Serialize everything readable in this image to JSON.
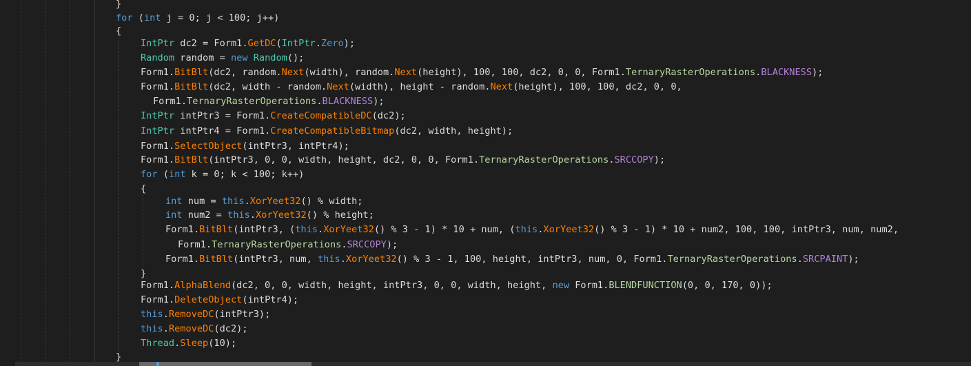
{
  "editor": {
    "lines": [
      {
        "indent": 0,
        "tokens": [
          [
            "pl",
            "}"
          ]
        ]
      },
      {
        "indent": 0,
        "tokens": [
          [
            "kw",
            "for"
          ],
          [
            "pl",
            " ("
          ],
          [
            "kw",
            "int"
          ],
          [
            "pl",
            " j = 0; j < 100; j++)"
          ]
        ]
      },
      {
        "indent": 0,
        "tokens": [
          [
            "pl",
            "{"
          ]
        ]
      },
      {
        "indent": 1,
        "tokens": [
          [
            "ty",
            "IntPtr"
          ],
          [
            "pl",
            " dc2 = "
          ],
          [
            "pl",
            "Form1."
          ],
          [
            "fn",
            "GetDC"
          ],
          [
            "pl",
            "("
          ],
          [
            "ty",
            "IntPtr"
          ],
          [
            "pl",
            "."
          ],
          [
            "kw",
            "Zero"
          ],
          [
            "pl",
            ");"
          ]
        ]
      },
      {
        "indent": 1,
        "tokens": [
          [
            "ty",
            "Random"
          ],
          [
            "pl",
            " random = "
          ],
          [
            "kw",
            "new"
          ],
          [
            "pl",
            " "
          ],
          [
            "ty",
            "Random"
          ],
          [
            "pl",
            "();"
          ]
        ]
      },
      {
        "indent": 1,
        "tokens": [
          [
            "pl",
            "Form1."
          ],
          [
            "fn",
            "BitBlt"
          ],
          [
            "pl",
            "(dc2, random."
          ],
          [
            "fn",
            "Next"
          ],
          [
            "pl",
            "(width), random."
          ],
          [
            "fn",
            "Next"
          ],
          [
            "pl",
            "(height), 100, 100, dc2, 0, 0, "
          ],
          [
            "pl",
            "Form1."
          ],
          [
            "en",
            "TernaryRasterOperations"
          ],
          [
            "pl",
            "."
          ],
          [
            "ev",
            "BLACKNESS"
          ],
          [
            "pl",
            ");"
          ]
        ]
      },
      {
        "indent": 1,
        "tokens": [
          [
            "pl",
            "Form1."
          ],
          [
            "fn",
            "BitBlt"
          ],
          [
            "pl",
            "(dc2, width - random."
          ],
          [
            "fn",
            "Next"
          ],
          [
            "pl",
            "(width), height - random."
          ],
          [
            "fn",
            "Next"
          ],
          [
            "pl",
            "(height), 100, 100, dc2, 0, 0,"
          ]
        ]
      },
      {
        "indent": 1,
        "extra": 2,
        "tokens": [
          [
            "pl",
            "Form1."
          ],
          [
            "en",
            "TernaryRasterOperations"
          ],
          [
            "pl",
            "."
          ],
          [
            "ev",
            "BLACKNESS"
          ],
          [
            "pl",
            ");"
          ]
        ]
      },
      {
        "indent": 1,
        "tokens": [
          [
            "ty",
            "IntPtr"
          ],
          [
            "pl",
            " intPtr3 = "
          ],
          [
            "pl",
            "Form1."
          ],
          [
            "fn",
            "CreateCompatibleDC"
          ],
          [
            "pl",
            "(dc2);"
          ]
        ]
      },
      {
        "indent": 1,
        "tokens": [
          [
            "ty",
            "IntPtr"
          ],
          [
            "pl",
            " intPtr4 = "
          ],
          [
            "pl",
            "Form1."
          ],
          [
            "fn",
            "CreateCompatibleBitmap"
          ],
          [
            "pl",
            "(dc2, width, height);"
          ]
        ]
      },
      {
        "indent": 1,
        "tokens": [
          [
            "pl",
            "Form1."
          ],
          [
            "fn",
            "SelectObject"
          ],
          [
            "pl",
            "(intPtr3, intPtr4);"
          ]
        ]
      },
      {
        "indent": 1,
        "tokens": [
          [
            "pl",
            "Form1."
          ],
          [
            "fn",
            "BitBlt"
          ],
          [
            "pl",
            "(intPtr3, 0, 0, width, height, dc2, 0, 0, "
          ],
          [
            "pl",
            "Form1."
          ],
          [
            "en",
            "TernaryRasterOperations"
          ],
          [
            "pl",
            "."
          ],
          [
            "ev",
            "SRCCOPY"
          ],
          [
            "pl",
            ");"
          ]
        ]
      },
      {
        "indent": 1,
        "tokens": [
          [
            "kw",
            "for"
          ],
          [
            "pl",
            " ("
          ],
          [
            "kw",
            "int"
          ],
          [
            "pl",
            " k = 0; k < 100; k++)"
          ]
        ]
      },
      {
        "indent": 1,
        "tokens": [
          [
            "pl",
            "{"
          ]
        ]
      },
      {
        "indent": 2,
        "tokens": [
          [
            "kw",
            "int"
          ],
          [
            "pl",
            " num = "
          ],
          [
            "kw",
            "this"
          ],
          [
            "pl",
            "."
          ],
          [
            "fn",
            "XorYeet32"
          ],
          [
            "pl",
            "() % width;"
          ]
        ]
      },
      {
        "indent": 2,
        "tokens": [
          [
            "kw",
            "int"
          ],
          [
            "pl",
            " num2 = "
          ],
          [
            "kw",
            "this"
          ],
          [
            "pl",
            "."
          ],
          [
            "fn",
            "XorYeet32"
          ],
          [
            "pl",
            "() % height;"
          ]
        ]
      },
      {
        "indent": 2,
        "tokens": [
          [
            "pl",
            "Form1."
          ],
          [
            "fn",
            "BitBlt"
          ],
          [
            "pl",
            "(intPtr3, ("
          ],
          [
            "kw",
            "this"
          ],
          [
            "pl",
            "."
          ],
          [
            "fn",
            "XorYeet32"
          ],
          [
            "pl",
            "() % 3 - 1) * 10 + num, ("
          ],
          [
            "kw",
            "this"
          ],
          [
            "pl",
            "."
          ],
          [
            "fn",
            "XorYeet32"
          ],
          [
            "pl",
            "() % 3 - 1) * 10 + num2, 100, 100, intPtr3, num, num2,"
          ]
        ]
      },
      {
        "indent": 2,
        "extra": 2,
        "tokens": [
          [
            "pl",
            "Form1."
          ],
          [
            "en",
            "TernaryRasterOperations"
          ],
          [
            "pl",
            "."
          ],
          [
            "ev",
            "SRCCOPY"
          ],
          [
            "pl",
            ");"
          ]
        ]
      },
      {
        "indent": 2,
        "tokens": [
          [
            "pl",
            "Form1."
          ],
          [
            "fn",
            "BitBlt"
          ],
          [
            "pl",
            "(intPtr3, num, "
          ],
          [
            "kw",
            "this"
          ],
          [
            "pl",
            "."
          ],
          [
            "fn",
            "XorYeet32"
          ],
          [
            "pl",
            "() % 3 - 1, 100, height, intPtr3, num, 0, "
          ],
          [
            "pl",
            "Form1."
          ],
          [
            "en",
            "TernaryRasterOperations"
          ],
          [
            "pl",
            "."
          ],
          [
            "ev",
            "SRCPAINT"
          ],
          [
            "pl",
            ");"
          ]
        ]
      },
      {
        "indent": 1,
        "tokens": [
          [
            "pl",
            "}"
          ]
        ]
      },
      {
        "indent": 1,
        "tokens": [
          [
            "pl",
            "Form1."
          ],
          [
            "fn",
            "AlphaBlend"
          ],
          [
            "pl",
            "(dc2, 0, 0, width, height, intPtr3, 0, 0, width, height, "
          ],
          [
            "kw",
            "new"
          ],
          [
            "pl",
            " Form1."
          ],
          [
            "en",
            "BLENDFUNCTION"
          ],
          [
            "pl",
            "(0, 0, 170, 0));"
          ]
        ]
      },
      {
        "indent": 1,
        "tokens": [
          [
            "pl",
            "Form1."
          ],
          [
            "fn",
            "DeleteObject"
          ],
          [
            "pl",
            "(intPtr4);"
          ]
        ]
      },
      {
        "indent": 1,
        "tokens": [
          [
            "kw",
            "this"
          ],
          [
            "pl",
            "."
          ],
          [
            "fn",
            "RemoveDC"
          ],
          [
            "pl",
            "(intPtr3);"
          ]
        ]
      },
      {
        "indent": 1,
        "tokens": [
          [
            "kw",
            "this"
          ],
          [
            "pl",
            "."
          ],
          [
            "fn",
            "RemoveDC"
          ],
          [
            "pl",
            "(dc2);"
          ]
        ]
      },
      {
        "indent": 1,
        "tokens": [
          [
            "ty",
            "Thread"
          ],
          [
            "pl",
            "."
          ],
          [
            "fn",
            "Sleep"
          ],
          [
            "pl",
            "(10);"
          ]
        ]
      },
      {
        "indent": 0,
        "tokens": [
          [
            "pl",
            "}"
          ]
        ]
      }
    ]
  },
  "colors": {
    "background": "#1e1e1e",
    "keyword": "#569cd6",
    "type": "#4ec9b0",
    "method": "#ff8000",
    "enum_value": "#b480d8",
    "plain": "#dcdcdc"
  }
}
